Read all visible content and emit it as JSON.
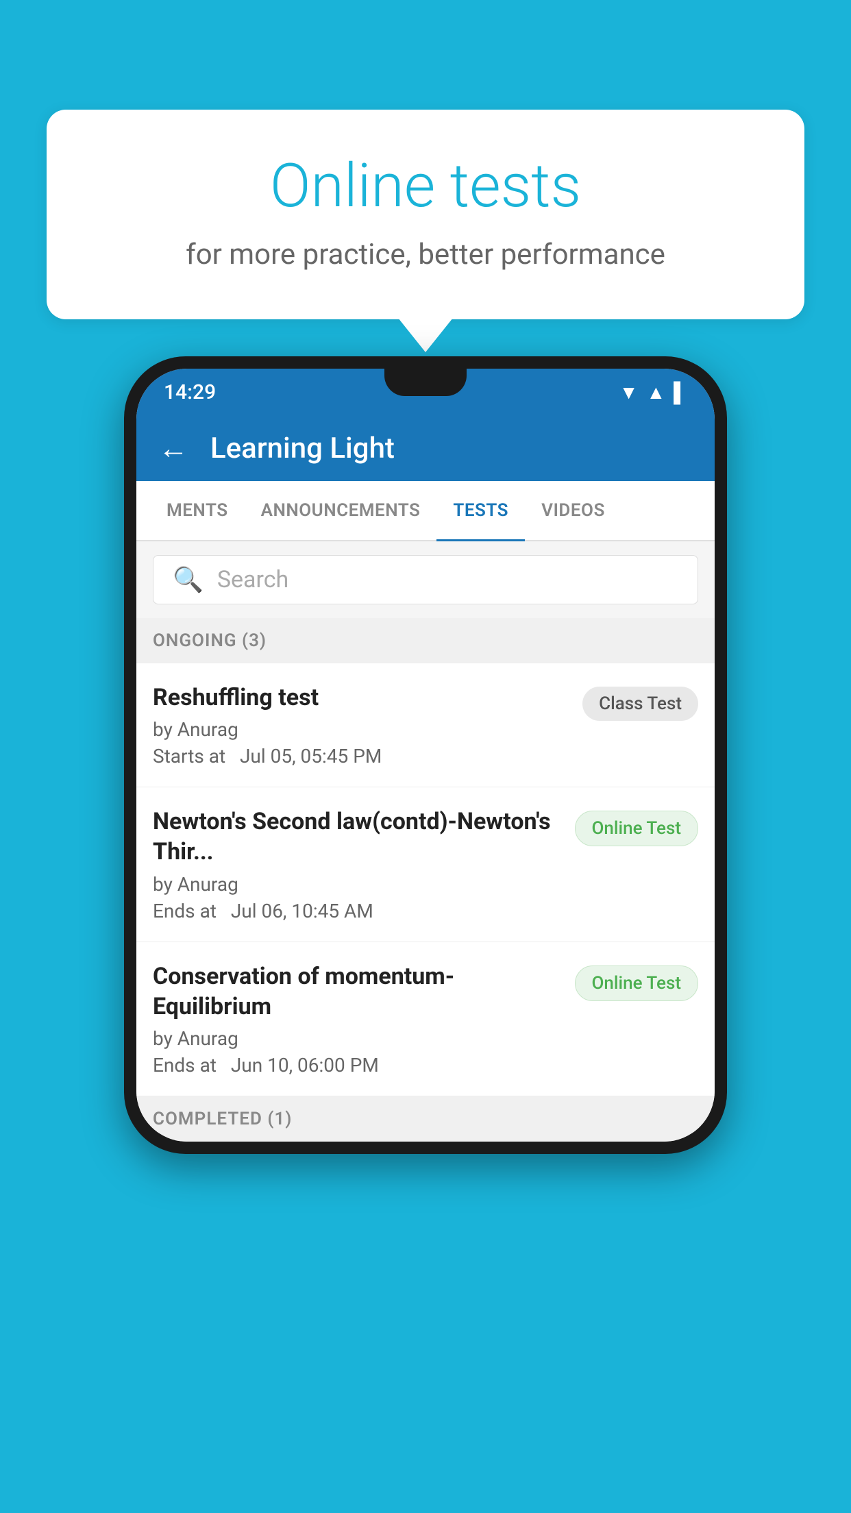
{
  "background_color": "#1ab3d8",
  "bubble": {
    "title": "Online tests",
    "subtitle": "for more practice, better performance"
  },
  "phone": {
    "status_bar": {
      "time": "14:29",
      "icons": [
        "▼",
        "▲",
        "▌"
      ]
    },
    "app_bar": {
      "back_label": "←",
      "title": "Learning Light"
    },
    "tabs": [
      {
        "label": "MENTS",
        "active": false
      },
      {
        "label": "ANNOUNCEMENTS",
        "active": false
      },
      {
        "label": "TESTS",
        "active": true
      },
      {
        "label": "VIDEOS",
        "active": false
      }
    ],
    "search": {
      "placeholder": "Search",
      "icon": "🔍"
    },
    "sections": [
      {
        "label": "ONGOING (3)",
        "tests": [
          {
            "name": "Reshuffling test",
            "by": "by Anurag",
            "time_label": "Starts at",
            "time": "Jul 05, 05:45 PM",
            "badge": "Class Test",
            "badge_type": "class"
          },
          {
            "name": "Newton's Second law(contd)-Newton's Thir...",
            "by": "by Anurag",
            "time_label": "Ends at",
            "time": "Jul 06, 10:45 AM",
            "badge": "Online Test",
            "badge_type": "online"
          },
          {
            "name": "Conservation of momentum-Equilibrium",
            "by": "by Anurag",
            "time_label": "Ends at",
            "time": "Jun 10, 06:00 PM",
            "badge": "Online Test",
            "badge_type": "online"
          }
        ]
      }
    ],
    "completed_label": "COMPLETED (1)"
  }
}
